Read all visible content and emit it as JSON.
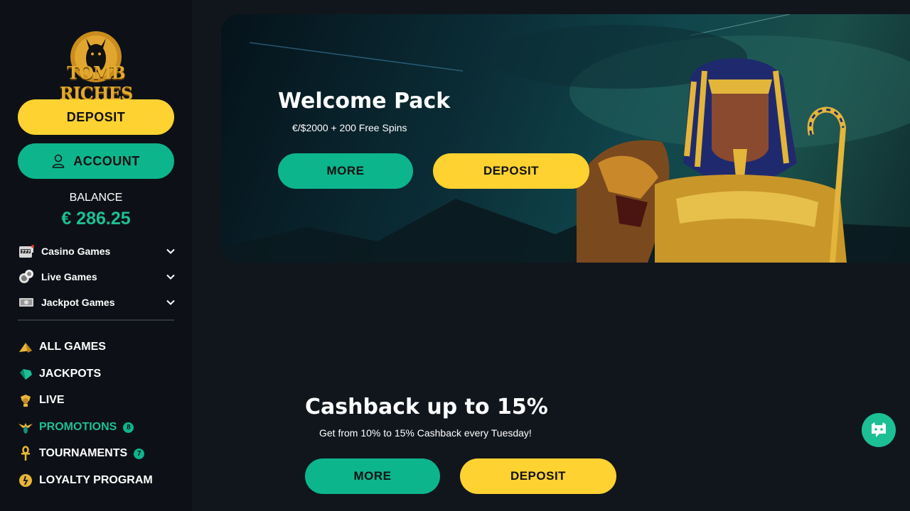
{
  "brand": {
    "name": "TOMB RICHES"
  },
  "sidebar": {
    "deposit_label": "DEPOSIT",
    "account_label": "ACCOUNT",
    "balance_label": "BALANCE",
    "balance_value": "€ 286.25",
    "categories": [
      {
        "label": "Casino Games",
        "icon": "slot-machine-icon"
      },
      {
        "label": "Live Games",
        "icon": "chips-icon"
      },
      {
        "label": "Jackpot Games",
        "icon": "money-stack-icon"
      }
    ],
    "nav": [
      {
        "label": "ALL GAMES",
        "icon": "pyramid-icon"
      },
      {
        "label": "JACKPOTS",
        "icon": "gem-icon"
      },
      {
        "label": "LIVE",
        "icon": "dealer-icon"
      },
      {
        "label": "PROMOTIONS",
        "icon": "scarab-icon",
        "badge": "8",
        "active": true
      },
      {
        "label": "TOURNAMENTS",
        "icon": "ankh-icon",
        "badge": "7"
      },
      {
        "label": "LOYALTY PROGRAM",
        "icon": "medal-icon"
      }
    ]
  },
  "banner": {
    "title": "Welcome Pack",
    "subtitle": "€/$2000 + 200 Free Spins",
    "more_label": "MORE",
    "deposit_label": "DEPOSIT"
  },
  "promo": {
    "title": "Cashback up to 15%",
    "subtitle": "Get from 10% to 15% Cashback every Tuesday!",
    "more_label": "MORE",
    "deposit_label": "DEPOSIT"
  },
  "colors": {
    "accent_green": "#0db58d",
    "accent_yellow": "#fdd231",
    "background": "#11161d",
    "sidebar": "#0d1117"
  }
}
